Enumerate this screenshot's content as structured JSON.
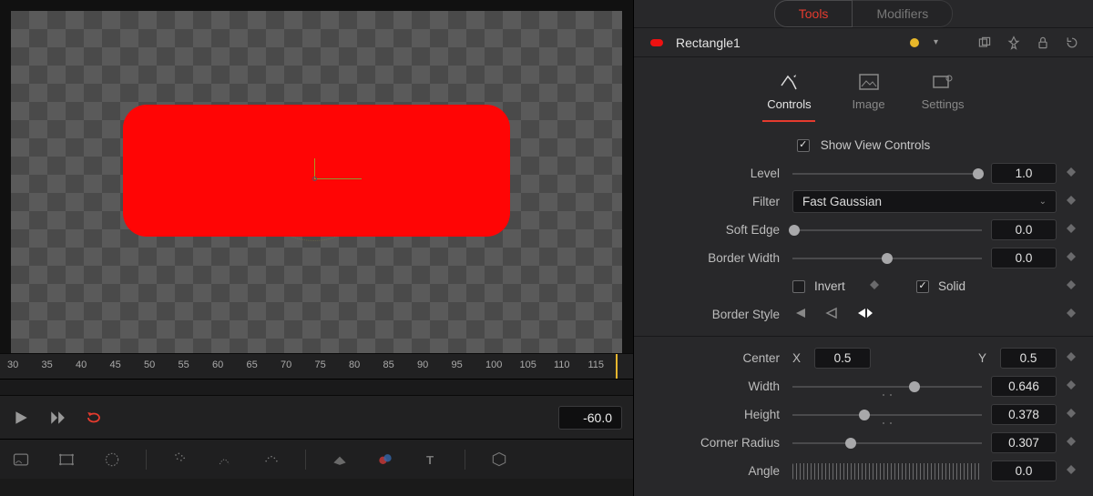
{
  "tabs": {
    "tools": "Tools",
    "modifiers": "Modifiers"
  },
  "node": {
    "name": "Rectangle1"
  },
  "subtabs": {
    "controls": "Controls",
    "image": "Image",
    "settings": "Settings"
  },
  "controls": {
    "show_view_controls": "Show View Controls",
    "level": {
      "label": "Level",
      "value": "1.0",
      "pos": 0.98
    },
    "filter": {
      "label": "Filter",
      "value": "Fast Gaussian"
    },
    "soft_edge": {
      "label": "Soft Edge",
      "value": "0.0",
      "pos": 0.0
    },
    "border_width": {
      "label": "Border Width",
      "value": "0.0",
      "pos": 0.5
    },
    "invert": {
      "label": "Invert",
      "checked": false
    },
    "solid": {
      "label": "Solid",
      "checked": true
    },
    "border_style": {
      "label": "Border Style"
    },
    "center": {
      "label": "Center",
      "x": "0.5",
      "y": "0.5"
    },
    "width": {
      "label": "Width",
      "value": "0.646",
      "pos": 0.646
    },
    "height": {
      "label": "Height",
      "value": "0.378",
      "pos": 0.378
    },
    "corner_radius": {
      "label": "Corner Radius",
      "value": "0.307",
      "pos": 0.307
    },
    "angle": {
      "label": "Angle",
      "value": "0.0"
    }
  },
  "ruler": {
    "ticks": [
      "30",
      "35",
      "40",
      "45",
      "50",
      "55",
      "60",
      "65",
      "70",
      "75",
      "80",
      "85",
      "90",
      "95",
      "100",
      "105",
      "110",
      "115"
    ]
  },
  "transport": {
    "value": "-60.0"
  }
}
